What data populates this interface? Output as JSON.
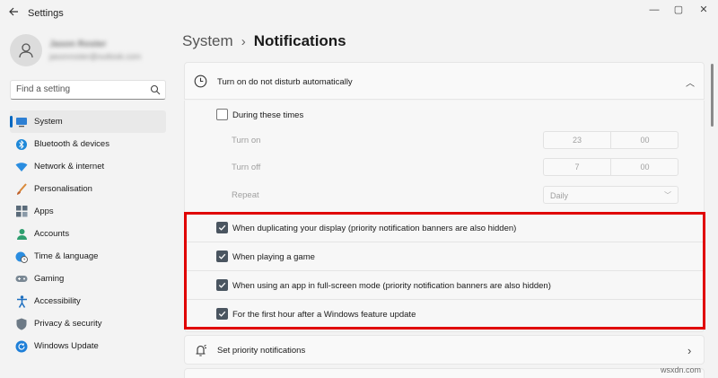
{
  "window": {
    "title": "Settings",
    "back_icon": "arrow-left-icon",
    "controls": {
      "minimize": "—",
      "maximize": "▢",
      "close": "✕"
    }
  },
  "account": {
    "name": "Jason Roster",
    "email": "jasonroster@outlook.com"
  },
  "search": {
    "placeholder": "Find a setting",
    "icon": "search-icon"
  },
  "sidebar": {
    "items": [
      {
        "label": "System",
        "icon": "monitor-icon",
        "active": true
      },
      {
        "label": "Bluetooth & devices",
        "icon": "bluetooth-icon"
      },
      {
        "label": "Network & internet",
        "icon": "wifi-icon"
      },
      {
        "label": "Personalisation",
        "icon": "brush-icon"
      },
      {
        "label": "Apps",
        "icon": "apps-icon"
      },
      {
        "label": "Accounts",
        "icon": "person-icon"
      },
      {
        "label": "Time & language",
        "icon": "globe-clock-icon"
      },
      {
        "label": "Gaming",
        "icon": "gamepad-icon"
      },
      {
        "label": "Accessibility",
        "icon": "accessibility-icon"
      },
      {
        "label": "Privacy & security",
        "icon": "shield-icon"
      },
      {
        "label": "Windows Update",
        "icon": "update-icon"
      }
    ]
  },
  "breadcrumb": {
    "parent": "System",
    "separator": "›",
    "current": "Notifications"
  },
  "dnd": {
    "label": "Turn on do not disturb automatically",
    "expanded": true,
    "chevron": "︿",
    "during_times": {
      "label": "During these times",
      "checked": false
    },
    "turn_on": {
      "label": "Turn on",
      "hour": "23",
      "minute": "00"
    },
    "turn_off": {
      "label": "Turn off",
      "hour": "7",
      "minute": "00"
    },
    "repeat": {
      "label": "Repeat",
      "value": "Daily",
      "chevron": "﹀"
    },
    "conditions": [
      {
        "label": "When duplicating your display (priority notification banners are also hidden)",
        "checked": true
      },
      {
        "label": "When playing a game",
        "checked": true
      },
      {
        "label": "When using an app in full-screen mode (priority notification banners are also hidden)",
        "checked": true
      },
      {
        "label": "For the first hour after a Windows feature update",
        "checked": true
      }
    ]
  },
  "priority": {
    "label": "Set priority notifications",
    "chevron": "›",
    "icon": "priority-bell-icon"
  },
  "colors": {
    "accent": "#0067c0",
    "highlight": "#e00000",
    "checkbox": "#4a5560"
  },
  "watermark": "wsxdn.com"
}
